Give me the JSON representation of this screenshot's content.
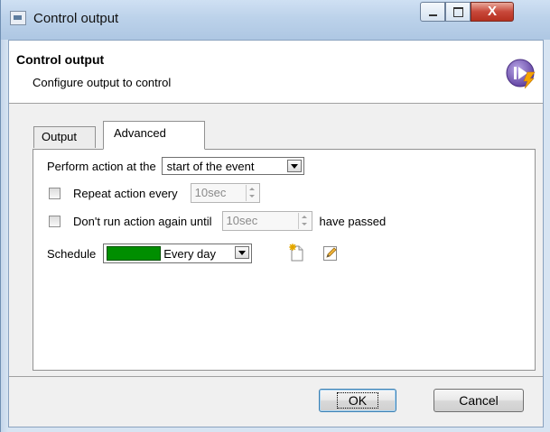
{
  "window": {
    "title": "Control output",
    "controls": {
      "minimize_icon": "minimize-icon",
      "maximize_icon": "maximize-icon",
      "close_label": "X"
    }
  },
  "header": {
    "title": "Control output",
    "subtitle": "Configure output to control",
    "logo_icon": "play-bolt-icon"
  },
  "tabs": [
    {
      "label": "Output",
      "selected": false
    },
    {
      "label": "Advanced",
      "selected": true
    }
  ],
  "advanced": {
    "perform_label": "Perform action at the",
    "perform_value": "start of the event",
    "repeat_label": "Repeat action every",
    "repeat_checked": false,
    "repeat_value": "10sec",
    "dont_run_label": "Don't run action again until",
    "dont_run_checked": false,
    "dont_run_value": "10sec",
    "dont_run_suffix": "have passed",
    "schedule_label": "Schedule",
    "schedule_value": "Every day",
    "schedule_color": "#008e00"
  },
  "buttons": {
    "ok": "OK",
    "cancel": "Cancel"
  }
}
